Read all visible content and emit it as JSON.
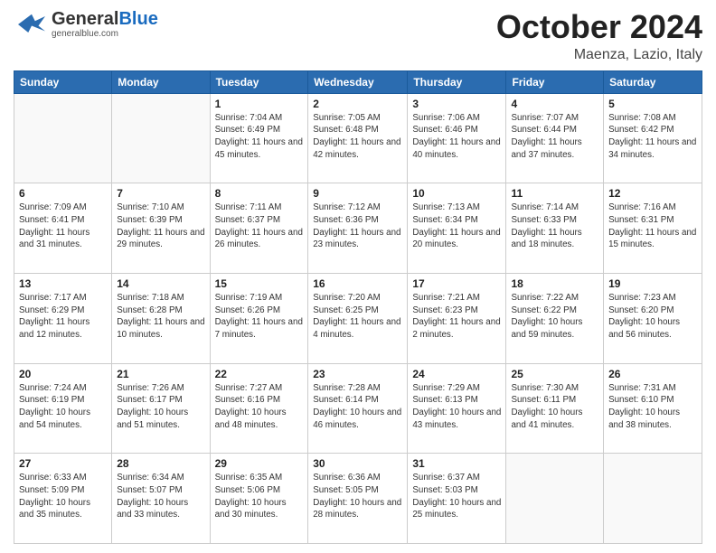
{
  "header": {
    "logo": {
      "line1": "General",
      "line2": "Blue",
      "tagline": "generalblue.com"
    },
    "month": "October 2024",
    "location": "Maenza, Lazio, Italy"
  },
  "weekdays": [
    "Sunday",
    "Monday",
    "Tuesday",
    "Wednesday",
    "Thursday",
    "Friday",
    "Saturday"
  ],
  "weeks": [
    [
      {
        "day": "",
        "info": ""
      },
      {
        "day": "",
        "info": ""
      },
      {
        "day": "1",
        "info": "Sunrise: 7:04 AM\nSunset: 6:49 PM\nDaylight: 11 hours and 45 minutes."
      },
      {
        "day": "2",
        "info": "Sunrise: 7:05 AM\nSunset: 6:48 PM\nDaylight: 11 hours and 42 minutes."
      },
      {
        "day": "3",
        "info": "Sunrise: 7:06 AM\nSunset: 6:46 PM\nDaylight: 11 hours and 40 minutes."
      },
      {
        "day": "4",
        "info": "Sunrise: 7:07 AM\nSunset: 6:44 PM\nDaylight: 11 hours and 37 minutes."
      },
      {
        "day": "5",
        "info": "Sunrise: 7:08 AM\nSunset: 6:42 PM\nDaylight: 11 hours and 34 minutes."
      }
    ],
    [
      {
        "day": "6",
        "info": "Sunrise: 7:09 AM\nSunset: 6:41 PM\nDaylight: 11 hours and 31 minutes."
      },
      {
        "day": "7",
        "info": "Sunrise: 7:10 AM\nSunset: 6:39 PM\nDaylight: 11 hours and 29 minutes."
      },
      {
        "day": "8",
        "info": "Sunrise: 7:11 AM\nSunset: 6:37 PM\nDaylight: 11 hours and 26 minutes."
      },
      {
        "day": "9",
        "info": "Sunrise: 7:12 AM\nSunset: 6:36 PM\nDaylight: 11 hours and 23 minutes."
      },
      {
        "day": "10",
        "info": "Sunrise: 7:13 AM\nSunset: 6:34 PM\nDaylight: 11 hours and 20 minutes."
      },
      {
        "day": "11",
        "info": "Sunrise: 7:14 AM\nSunset: 6:33 PM\nDaylight: 11 hours and 18 minutes."
      },
      {
        "day": "12",
        "info": "Sunrise: 7:16 AM\nSunset: 6:31 PM\nDaylight: 11 hours and 15 minutes."
      }
    ],
    [
      {
        "day": "13",
        "info": "Sunrise: 7:17 AM\nSunset: 6:29 PM\nDaylight: 11 hours and 12 minutes."
      },
      {
        "day": "14",
        "info": "Sunrise: 7:18 AM\nSunset: 6:28 PM\nDaylight: 11 hours and 10 minutes."
      },
      {
        "day": "15",
        "info": "Sunrise: 7:19 AM\nSunset: 6:26 PM\nDaylight: 11 hours and 7 minutes."
      },
      {
        "day": "16",
        "info": "Sunrise: 7:20 AM\nSunset: 6:25 PM\nDaylight: 11 hours and 4 minutes."
      },
      {
        "day": "17",
        "info": "Sunrise: 7:21 AM\nSunset: 6:23 PM\nDaylight: 11 hours and 2 minutes."
      },
      {
        "day": "18",
        "info": "Sunrise: 7:22 AM\nSunset: 6:22 PM\nDaylight: 10 hours and 59 minutes."
      },
      {
        "day": "19",
        "info": "Sunrise: 7:23 AM\nSunset: 6:20 PM\nDaylight: 10 hours and 56 minutes."
      }
    ],
    [
      {
        "day": "20",
        "info": "Sunrise: 7:24 AM\nSunset: 6:19 PM\nDaylight: 10 hours and 54 minutes."
      },
      {
        "day": "21",
        "info": "Sunrise: 7:26 AM\nSunset: 6:17 PM\nDaylight: 10 hours and 51 minutes."
      },
      {
        "day": "22",
        "info": "Sunrise: 7:27 AM\nSunset: 6:16 PM\nDaylight: 10 hours and 48 minutes."
      },
      {
        "day": "23",
        "info": "Sunrise: 7:28 AM\nSunset: 6:14 PM\nDaylight: 10 hours and 46 minutes."
      },
      {
        "day": "24",
        "info": "Sunrise: 7:29 AM\nSunset: 6:13 PM\nDaylight: 10 hours and 43 minutes."
      },
      {
        "day": "25",
        "info": "Sunrise: 7:30 AM\nSunset: 6:11 PM\nDaylight: 10 hours and 41 minutes."
      },
      {
        "day": "26",
        "info": "Sunrise: 7:31 AM\nSunset: 6:10 PM\nDaylight: 10 hours and 38 minutes."
      }
    ],
    [
      {
        "day": "27",
        "info": "Sunrise: 6:33 AM\nSunset: 5:09 PM\nDaylight: 10 hours and 35 minutes."
      },
      {
        "day": "28",
        "info": "Sunrise: 6:34 AM\nSunset: 5:07 PM\nDaylight: 10 hours and 33 minutes."
      },
      {
        "day": "29",
        "info": "Sunrise: 6:35 AM\nSunset: 5:06 PM\nDaylight: 10 hours and 30 minutes."
      },
      {
        "day": "30",
        "info": "Sunrise: 6:36 AM\nSunset: 5:05 PM\nDaylight: 10 hours and 28 minutes."
      },
      {
        "day": "31",
        "info": "Sunrise: 6:37 AM\nSunset: 5:03 PM\nDaylight: 10 hours and 25 minutes."
      },
      {
        "day": "",
        "info": ""
      },
      {
        "day": "",
        "info": ""
      }
    ]
  ]
}
